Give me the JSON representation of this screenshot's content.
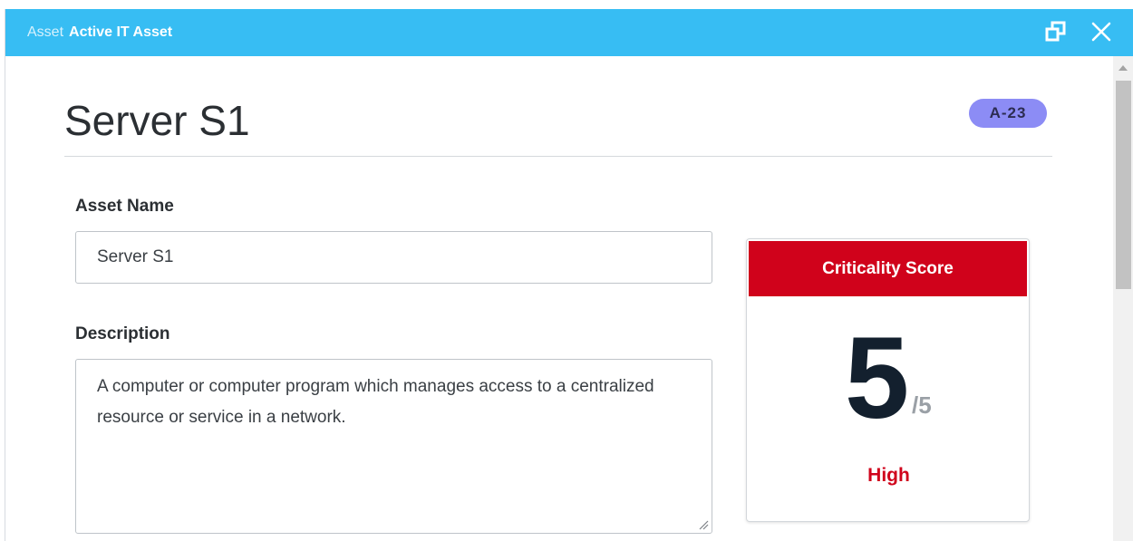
{
  "titlebar": {
    "breadcrumb_parent": "Asset",
    "breadcrumb_current": "Active IT Asset",
    "color": "#37bdf3"
  },
  "record": {
    "title": "Server S1",
    "id_badge": "A-23",
    "badge_color": "#8c8cf5"
  },
  "fields": {
    "asset_name_label": "Asset Name",
    "asset_name_value": "Server S1",
    "description_label": "Description",
    "description_value": "A computer or computer program which manages access to a centralized resource or service in a network."
  },
  "criticality": {
    "header": "Criticality Score",
    "value": "5",
    "max": "/5",
    "level": "High",
    "accent_color": "#d0021b"
  },
  "icons": {
    "restore": "restore-window-icon",
    "close": "close-icon",
    "scroll_up": "scroll-up-arrow-icon",
    "resize": "resize-grip-icon"
  }
}
